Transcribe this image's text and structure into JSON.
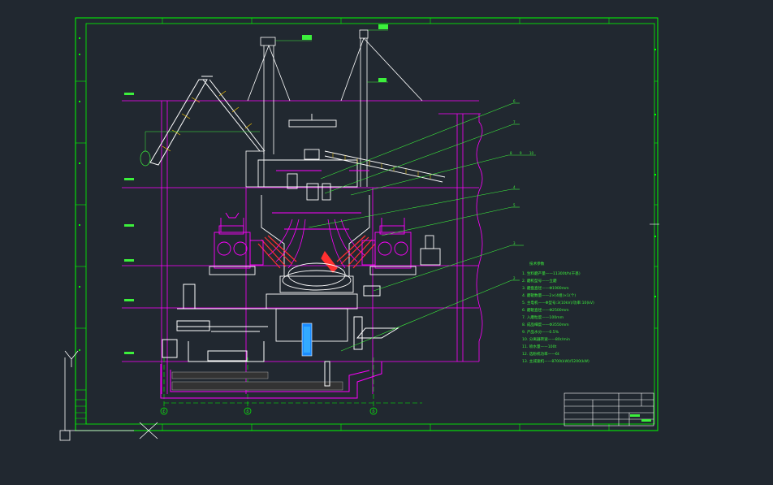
{
  "drawing": {
    "notes_title": "技术参数",
    "notes": [
      "1. 生料磨产量——11300t/h(干基)",
      "2. 磨机型号——立磨",
      "3. 磨盘直径——Φ1900mm",
      "4. 磨辊数量——2×(4组)×1(个)",
      "5. 主电机——Φ型号:3(10kV)/功率:10(kV)",
      "6. 磨辊直径——Φ2500mm",
      "7. 入磨粒度——100mm",
      "8. 成品细度——Φ3550mm",
      "9. 产品水分——0.5%",
      "10. 分离器转速——80r/min",
      "11. 喷水量——100t",
      "12. 选粉机功率——6t",
      "13. 主减速机——8700(kW)/5200(kW)"
    ],
    "column_markers": [
      "①",
      "②",
      "③"
    ],
    "callout_tags": [
      "6",
      "7",
      "8",
      "9",
      "10",
      "4",
      "5",
      "3",
      "2"
    ],
    "title_block_rows": [
      "",
      "",
      "",
      "",
      ""
    ]
  },
  "colors": {
    "background": "#212830",
    "frame": "#00ff00",
    "equipment": "#ff00ff",
    "structure": "#ffffff",
    "annotations": "#3cf03c",
    "accent_red": "#ff3030"
  }
}
